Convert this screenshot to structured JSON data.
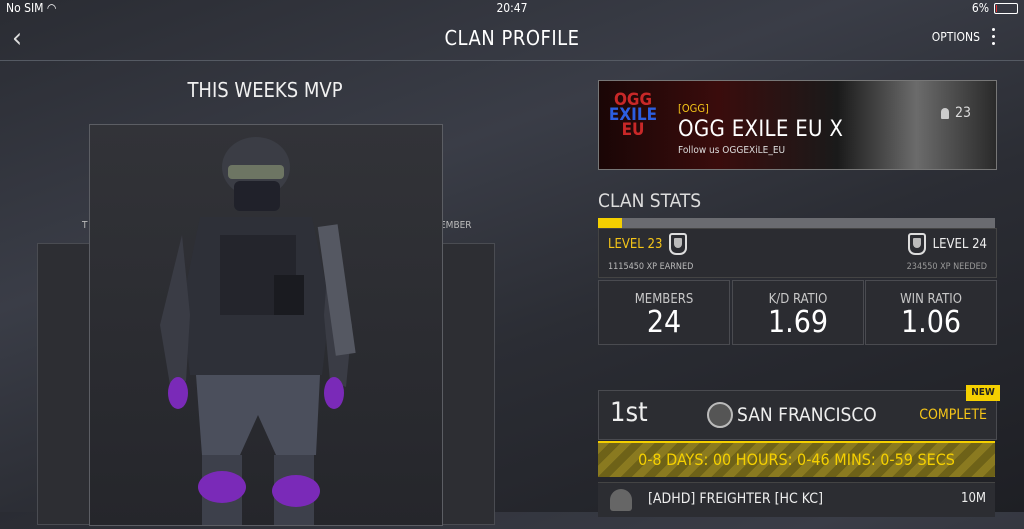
{
  "status_bar": {
    "carrier": "No SIM",
    "time": "20:47",
    "battery": "6%",
    "battery_level": 0.06
  },
  "nav": {
    "title": "CLAN PROFILE",
    "options_label": "OPTIONS"
  },
  "mvp": {
    "title": "THIS WEEKS MVP",
    "side_label_left": "T",
    "side_label_right": "EMBER"
  },
  "clan": {
    "tag": "[OGG]",
    "name": "OGG EXILE EU X",
    "follow": "Follow us OGGEXiLE_EU",
    "member_count": "23",
    "logo_lines": [
      "OGG",
      "EXILE",
      "EU"
    ]
  },
  "stats": {
    "title": "CLAN STATS",
    "xp_progress": 0.06,
    "level_current": "LEVEL 23",
    "level_next": "LEVEL 24",
    "xp_earned": "1115450 XP EARNED",
    "xp_needed": "234550 XP NEEDED",
    "boxes": [
      {
        "label": "MEMBERS",
        "value": "24"
      },
      {
        "label": "K/D RATIO",
        "value": "1.69"
      },
      {
        "label": "WIN RATIO",
        "value": "1.06"
      }
    ]
  },
  "event": {
    "badge": "NEW",
    "rank": "1st",
    "city": "SAN FRANCISCO",
    "status": "COMPLETE",
    "timer": "0-8 DAYS: 00 HOURS: 0-46 MINS: 0-59 SECS"
  },
  "member_row": {
    "name": "[ADHD]  FREIGHTER [HC KC]",
    "time": "10M"
  },
  "colors": {
    "accent": "#f5d000",
    "bg": "#2a2c33"
  }
}
